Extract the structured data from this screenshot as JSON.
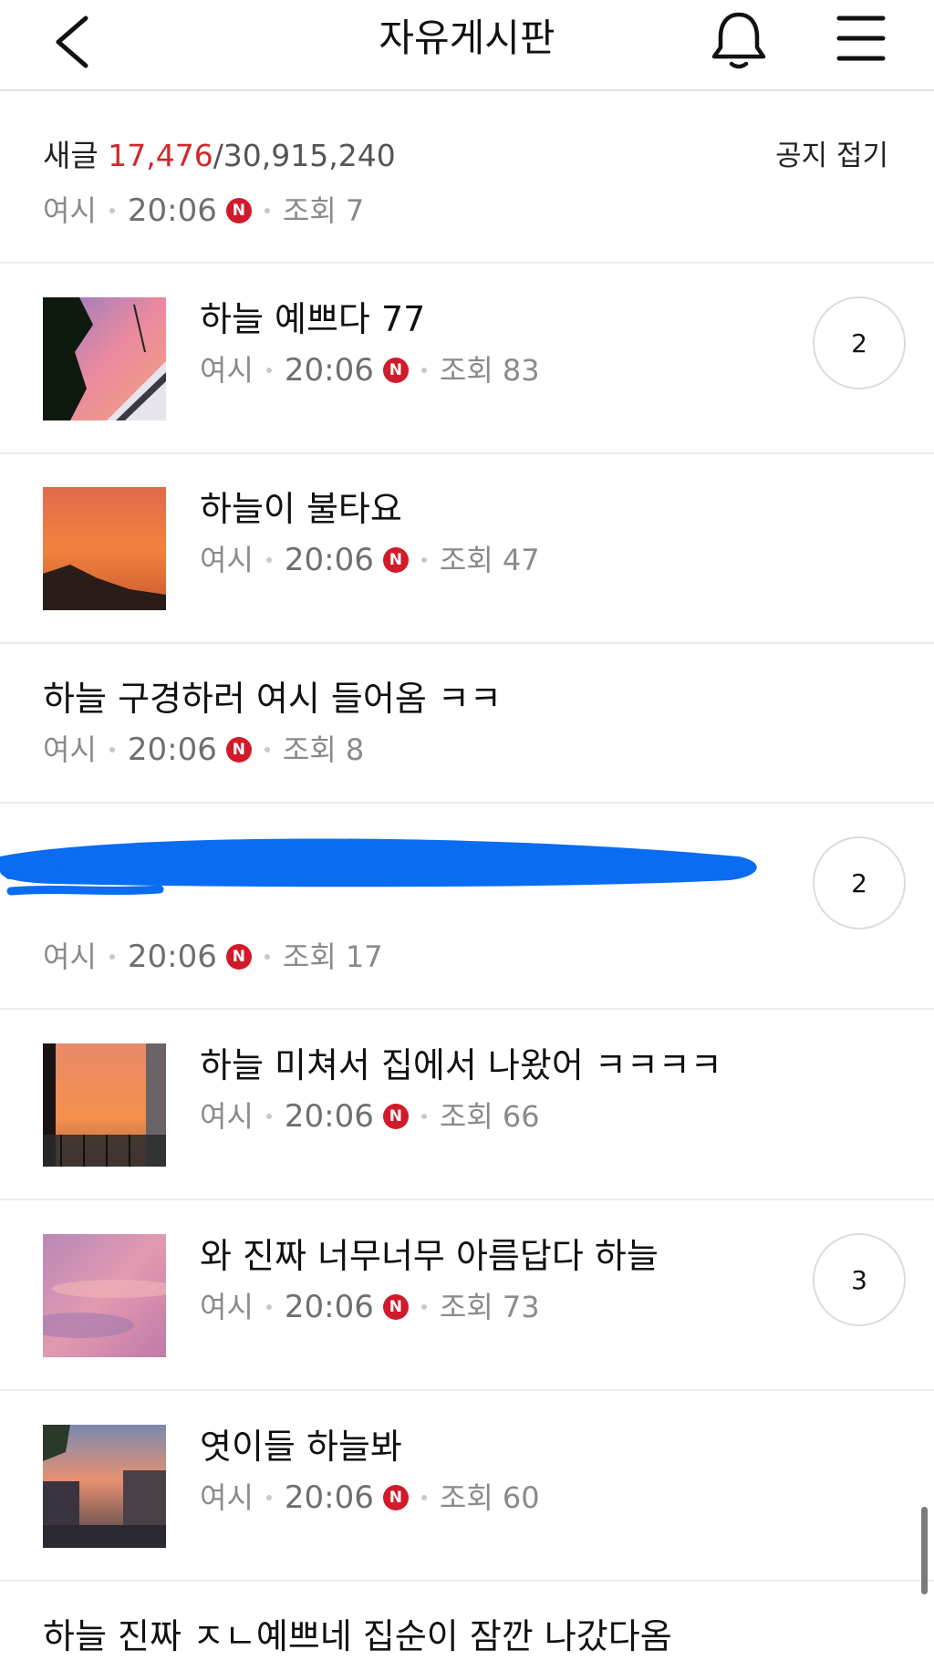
{
  "header": {
    "title": "자유게시판",
    "back_icon": "chevron-left-icon",
    "bell_icon": "bell-icon",
    "menu_icon": "hamburger-menu-icon"
  },
  "notice": {
    "prefix": "새글 ",
    "new_count": "17,476",
    "total_count": "/30,915,240",
    "fold_label": "공지 접기",
    "author": "여시",
    "time": "20:06",
    "badge": "N",
    "views": "조회 7"
  },
  "posts": [
    {
      "title": "하늘 예쁘다 77",
      "author": "여시",
      "time": "20:06",
      "badge": "N",
      "views": "조회 83",
      "comments": "2",
      "thumbnail": "sunset-photo-trees-building"
    },
    {
      "title": "하늘이 불타요",
      "author": "여시",
      "time": "20:06",
      "badge": "N",
      "views": "조회 47",
      "thumbnail": "orange-sunset-mountain"
    },
    {
      "title": "하늘 구경하러 여시 들어옴 ㅋㅋ",
      "author": "여시",
      "time": "20:06",
      "badge": "N",
      "views": "조회 8"
    },
    {
      "title": "",
      "author": "여시",
      "time": "20:06",
      "badge": "N",
      "views": "조회 17",
      "comments": "2",
      "redacted": true
    },
    {
      "title": "하늘 미쳐서 집에서 나왔어 ㅋㅋㅋㅋ",
      "author": "여시",
      "time": "20:06",
      "badge": "N",
      "views": "조회 66",
      "thumbnail": "orange-sky-balcony"
    },
    {
      "title": "와 진짜 너무너무 아름답다 하늘",
      "author": "여시",
      "time": "20:06",
      "badge": "N",
      "views": "조회 73",
      "comments": "3",
      "thumbnail": "pink-clouds"
    },
    {
      "title": "엿이들 하늘봐",
      "author": "여시",
      "time": "20:06",
      "badge": "N",
      "views": "조회 60",
      "thumbnail": "sunset-street"
    },
    {
      "title": "하늘 진짜 ㅈㄴ예쁘네 집순이 잠깐 나갔다옴"
    }
  ],
  "colors": {
    "accent_red": "#d0282c",
    "badge_red": "#d11a2a",
    "redaction_blue": "#0a6cf0",
    "meta_gray": "#8a8a8a"
  }
}
